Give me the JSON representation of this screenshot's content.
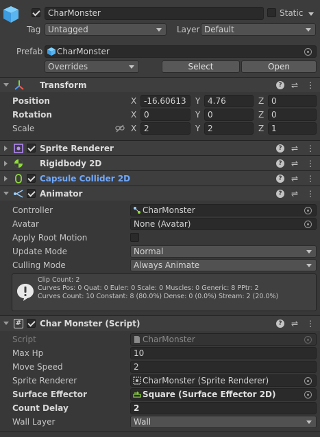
{
  "object": {
    "name": "CharMonster",
    "static_label": "Static",
    "tag_label": "Tag",
    "tag_value": "Untagged",
    "layer_label": "Layer",
    "layer_value": "Default",
    "prefab_label": "Prefab",
    "prefab_value": "CharMonster",
    "overrides_label": "Overrides",
    "select_label": "Select",
    "open_label": "Open"
  },
  "transform": {
    "title": "Transform",
    "position_label": "Position",
    "rotation_label": "Rotation",
    "scale_label": "Scale",
    "position": {
      "x": "-16.60613",
      "y": "4.76",
      "z": "0"
    },
    "rotation": {
      "x": "0",
      "y": "0",
      "z": "0"
    },
    "scale": {
      "x": "2",
      "y": "2",
      "z": "1"
    },
    "axis": {
      "x": "X",
      "y": "Y",
      "z": "Z"
    }
  },
  "components": {
    "sprite_renderer": "Sprite Renderer",
    "rigidbody": "Rigidbody 2D",
    "capsule_collider": "Capsule Collider 2D"
  },
  "animator": {
    "title": "Animator",
    "controller_label": "Controller",
    "controller_value": "CharMonster",
    "avatar_label": "Avatar",
    "avatar_value": "None (Avatar)",
    "apply_root_motion_label": "Apply Root Motion",
    "update_mode_label": "Update Mode",
    "update_mode_value": "Normal",
    "culling_mode_label": "Culling Mode",
    "culling_mode_value": "Always Animate",
    "info_line1": "Clip Count: 2",
    "info_line2": "Curves Pos: 0 Quat: 0 Euler: 0 Scale: 0 Muscles: 0 Generic: 8 PPtr: 2",
    "info_line3": "Curves Count: 10 Constant: 8 (80.0%) Dense: 0 (0.0%) Stream: 2 (20.0%)"
  },
  "script": {
    "title": "Char Monster (Script)",
    "script_label": "Script",
    "script_value": "CharMonster",
    "max_hp_label": "Max Hp",
    "max_hp_value": "10",
    "move_speed_label": "Move Speed",
    "move_speed_value": "2",
    "sprite_renderer_label": "Sprite Renderer",
    "sprite_renderer_value": "CharMonster (Sprite Renderer)",
    "surface_effector_label": "Surface Effector",
    "surface_effector_value": "Square (Surface Effector 2D)",
    "count_delay_label": "Count Delay",
    "count_delay_value": "2",
    "wall_layer_label": "Wall Layer",
    "wall_layer_value": "Wall"
  },
  "colors": {
    "background": "#383838",
    "field": "#2a2a2a",
    "header": "#3e3e3e",
    "link_blue": "#6fa8ff"
  }
}
